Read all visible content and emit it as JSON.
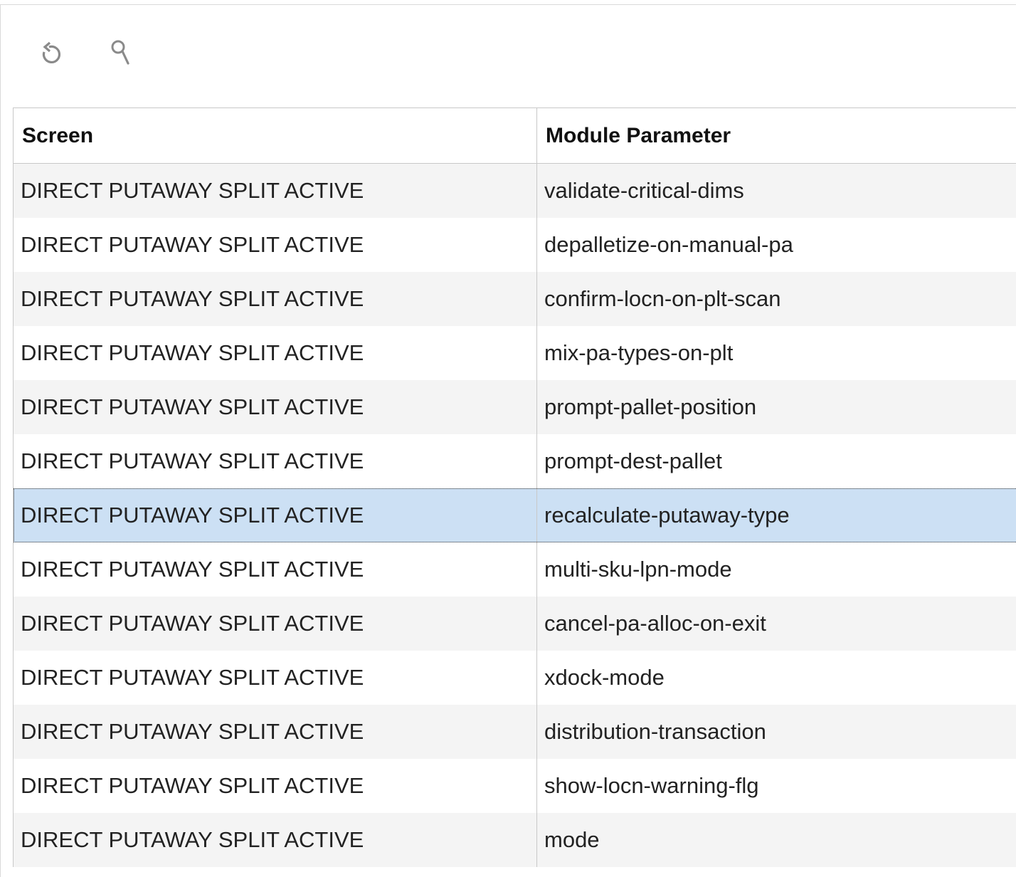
{
  "toolbar": {
    "refresh_icon": "refresh-icon",
    "search_icon": "search-icon"
  },
  "table": {
    "columns": [
      "Screen",
      "Module Parameter"
    ],
    "selected_index": 6,
    "rows": [
      {
        "screen": "DIRECT PUTAWAY SPLIT ACTIVE",
        "param": "validate-critical-dims"
      },
      {
        "screen": "DIRECT PUTAWAY SPLIT ACTIVE",
        "param": "depalletize-on-manual-pa"
      },
      {
        "screen": "DIRECT PUTAWAY SPLIT ACTIVE",
        "param": "confirm-locn-on-plt-scan"
      },
      {
        "screen": "DIRECT PUTAWAY SPLIT ACTIVE",
        "param": "mix-pa-types-on-plt"
      },
      {
        "screen": "DIRECT PUTAWAY SPLIT ACTIVE",
        "param": "prompt-pallet-position"
      },
      {
        "screen": "DIRECT PUTAWAY SPLIT ACTIVE",
        "param": "prompt-dest-pallet"
      },
      {
        "screen": "DIRECT PUTAWAY SPLIT ACTIVE",
        "param": "recalculate-putaway-type"
      },
      {
        "screen": "DIRECT PUTAWAY SPLIT ACTIVE",
        "param": "multi-sku-lpn-mode"
      },
      {
        "screen": "DIRECT PUTAWAY SPLIT ACTIVE",
        "param": "cancel-pa-alloc-on-exit"
      },
      {
        "screen": "DIRECT PUTAWAY SPLIT ACTIVE",
        "param": "xdock-mode"
      },
      {
        "screen": "DIRECT PUTAWAY SPLIT ACTIVE",
        "param": "distribution-transaction"
      },
      {
        "screen": "DIRECT PUTAWAY SPLIT ACTIVE",
        "param": "show-locn-warning-flg"
      },
      {
        "screen": "DIRECT PUTAWAY SPLIT ACTIVE",
        "param": "mode"
      }
    ]
  }
}
